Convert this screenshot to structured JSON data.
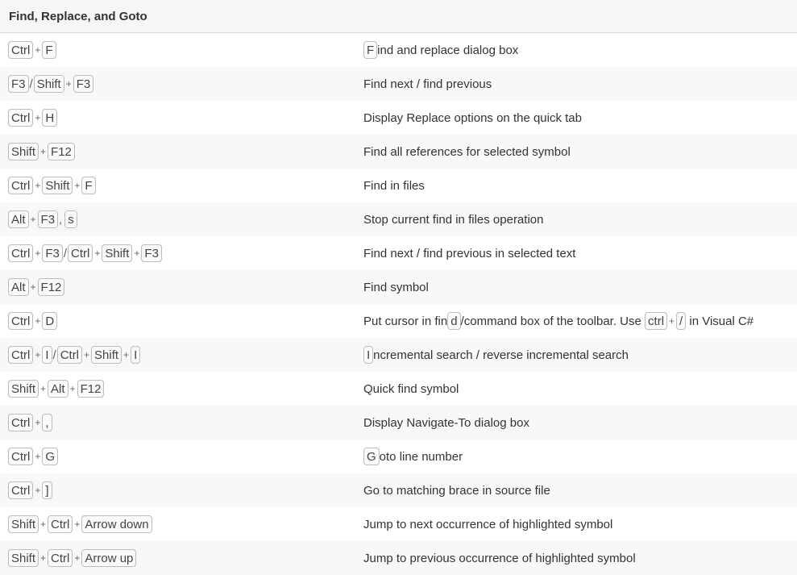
{
  "header": {
    "title": "Find, Replace, and Goto"
  },
  "rows": [
    {
      "keys": [
        {
          "k": "Ctrl"
        },
        {
          "s": "+"
        },
        {
          "k": "F"
        }
      ],
      "desc": [
        {
          "k": "F"
        },
        {
          "t": "ind and replace dialog box"
        }
      ]
    },
    {
      "keys": [
        {
          "k": "F3"
        },
        {
          "s": "/"
        },
        {
          "k": "Shift"
        },
        {
          "s": "+"
        },
        {
          "k": "F3"
        }
      ],
      "desc": [
        {
          "t": "Find next / find previous"
        }
      ]
    },
    {
      "keys": [
        {
          "k": "Ctrl"
        },
        {
          "s": "+"
        },
        {
          "k": "H"
        }
      ],
      "desc": [
        {
          "t": "Display Replace options on the quick tab"
        }
      ]
    },
    {
      "keys": [
        {
          "k": "Shift"
        },
        {
          "s": "+"
        },
        {
          "k": "F12"
        }
      ],
      "desc": [
        {
          "t": "Find all references for selected symbol"
        }
      ]
    },
    {
      "keys": [
        {
          "k": "Ctrl"
        },
        {
          "s": "+"
        },
        {
          "k": "Shift"
        },
        {
          "s": "+"
        },
        {
          "k": "F"
        }
      ],
      "desc": [
        {
          "t": "Find in files"
        }
      ]
    },
    {
      "keys": [
        {
          "k": "Alt"
        },
        {
          "s": "+"
        },
        {
          "k": "F3"
        },
        {
          "s": ","
        },
        {
          "k": "s"
        }
      ],
      "desc": [
        {
          "t": "Stop current find in files operation"
        }
      ]
    },
    {
      "keys": [
        {
          "k": "Ctrl"
        },
        {
          "s": "+"
        },
        {
          "k": "F3"
        },
        {
          "s": "/"
        },
        {
          "k": "Ctrl"
        },
        {
          "s": "+"
        },
        {
          "k": "Shift"
        },
        {
          "s": "+"
        },
        {
          "k": "F3"
        }
      ],
      "desc": [
        {
          "t": "Find next / find previous in selected text"
        }
      ]
    },
    {
      "keys": [
        {
          "k": "Alt"
        },
        {
          "s": "+"
        },
        {
          "k": "F12"
        }
      ],
      "desc": [
        {
          "t": "Find symbol"
        }
      ]
    },
    {
      "keys": [
        {
          "k": "Ctrl"
        },
        {
          "s": "+"
        },
        {
          "k": "D"
        }
      ],
      "desc": [
        {
          "t": "Put cursor in fin"
        },
        {
          "k": "d"
        },
        {
          "t": "/command box of the toolbar. Use "
        },
        {
          "k": "ctrl"
        },
        {
          "s": "+"
        },
        {
          "k": "/"
        },
        {
          "t": " in Visual C#"
        }
      ]
    },
    {
      "keys": [
        {
          "k": "Ctrl"
        },
        {
          "s": "+"
        },
        {
          "k": "I"
        },
        {
          "s": "/"
        },
        {
          "k": "Ctrl"
        },
        {
          "s": "+"
        },
        {
          "k": "Shift"
        },
        {
          "s": "+"
        },
        {
          "k": "I"
        }
      ],
      "desc": [
        {
          "k": "I"
        },
        {
          "t": "ncremental search / reverse incremental search"
        }
      ]
    },
    {
      "keys": [
        {
          "k": "Shift"
        },
        {
          "s": "+"
        },
        {
          "k": "Alt"
        },
        {
          "s": "+"
        },
        {
          "k": "F12"
        }
      ],
      "desc": [
        {
          "t": "Quick find symbol"
        }
      ]
    },
    {
      "keys": [
        {
          "k": "Ctrl"
        },
        {
          "s": "+"
        },
        {
          "k": ","
        }
      ],
      "desc": [
        {
          "t": "Display Navigate-To dialog box"
        }
      ]
    },
    {
      "keys": [
        {
          "k": "Ctrl"
        },
        {
          "s": "+"
        },
        {
          "k": "G"
        }
      ],
      "desc": [
        {
          "k": "G"
        },
        {
          "t": "oto line number"
        }
      ]
    },
    {
      "keys": [
        {
          "k": "Ctrl"
        },
        {
          "s": "+"
        },
        {
          "k": "]"
        }
      ],
      "desc": [
        {
          "t": "Go to matching brace in source file"
        }
      ]
    },
    {
      "keys": [
        {
          "k": "Shift"
        },
        {
          "s": "+"
        },
        {
          "k": "Ctrl"
        },
        {
          "s": "+"
        },
        {
          "k": "Arrow down"
        }
      ],
      "desc": [
        {
          "t": "Jump to next occurrence of highlighted symbol"
        }
      ]
    },
    {
      "keys": [
        {
          "k": "Shift"
        },
        {
          "s": "+"
        },
        {
          "k": "Ctrl"
        },
        {
          "s": "+"
        },
        {
          "k": "Arrow up"
        }
      ],
      "desc": [
        {
          "t": "Jump to previous occurrence of highlighted symbol"
        }
      ]
    }
  ]
}
